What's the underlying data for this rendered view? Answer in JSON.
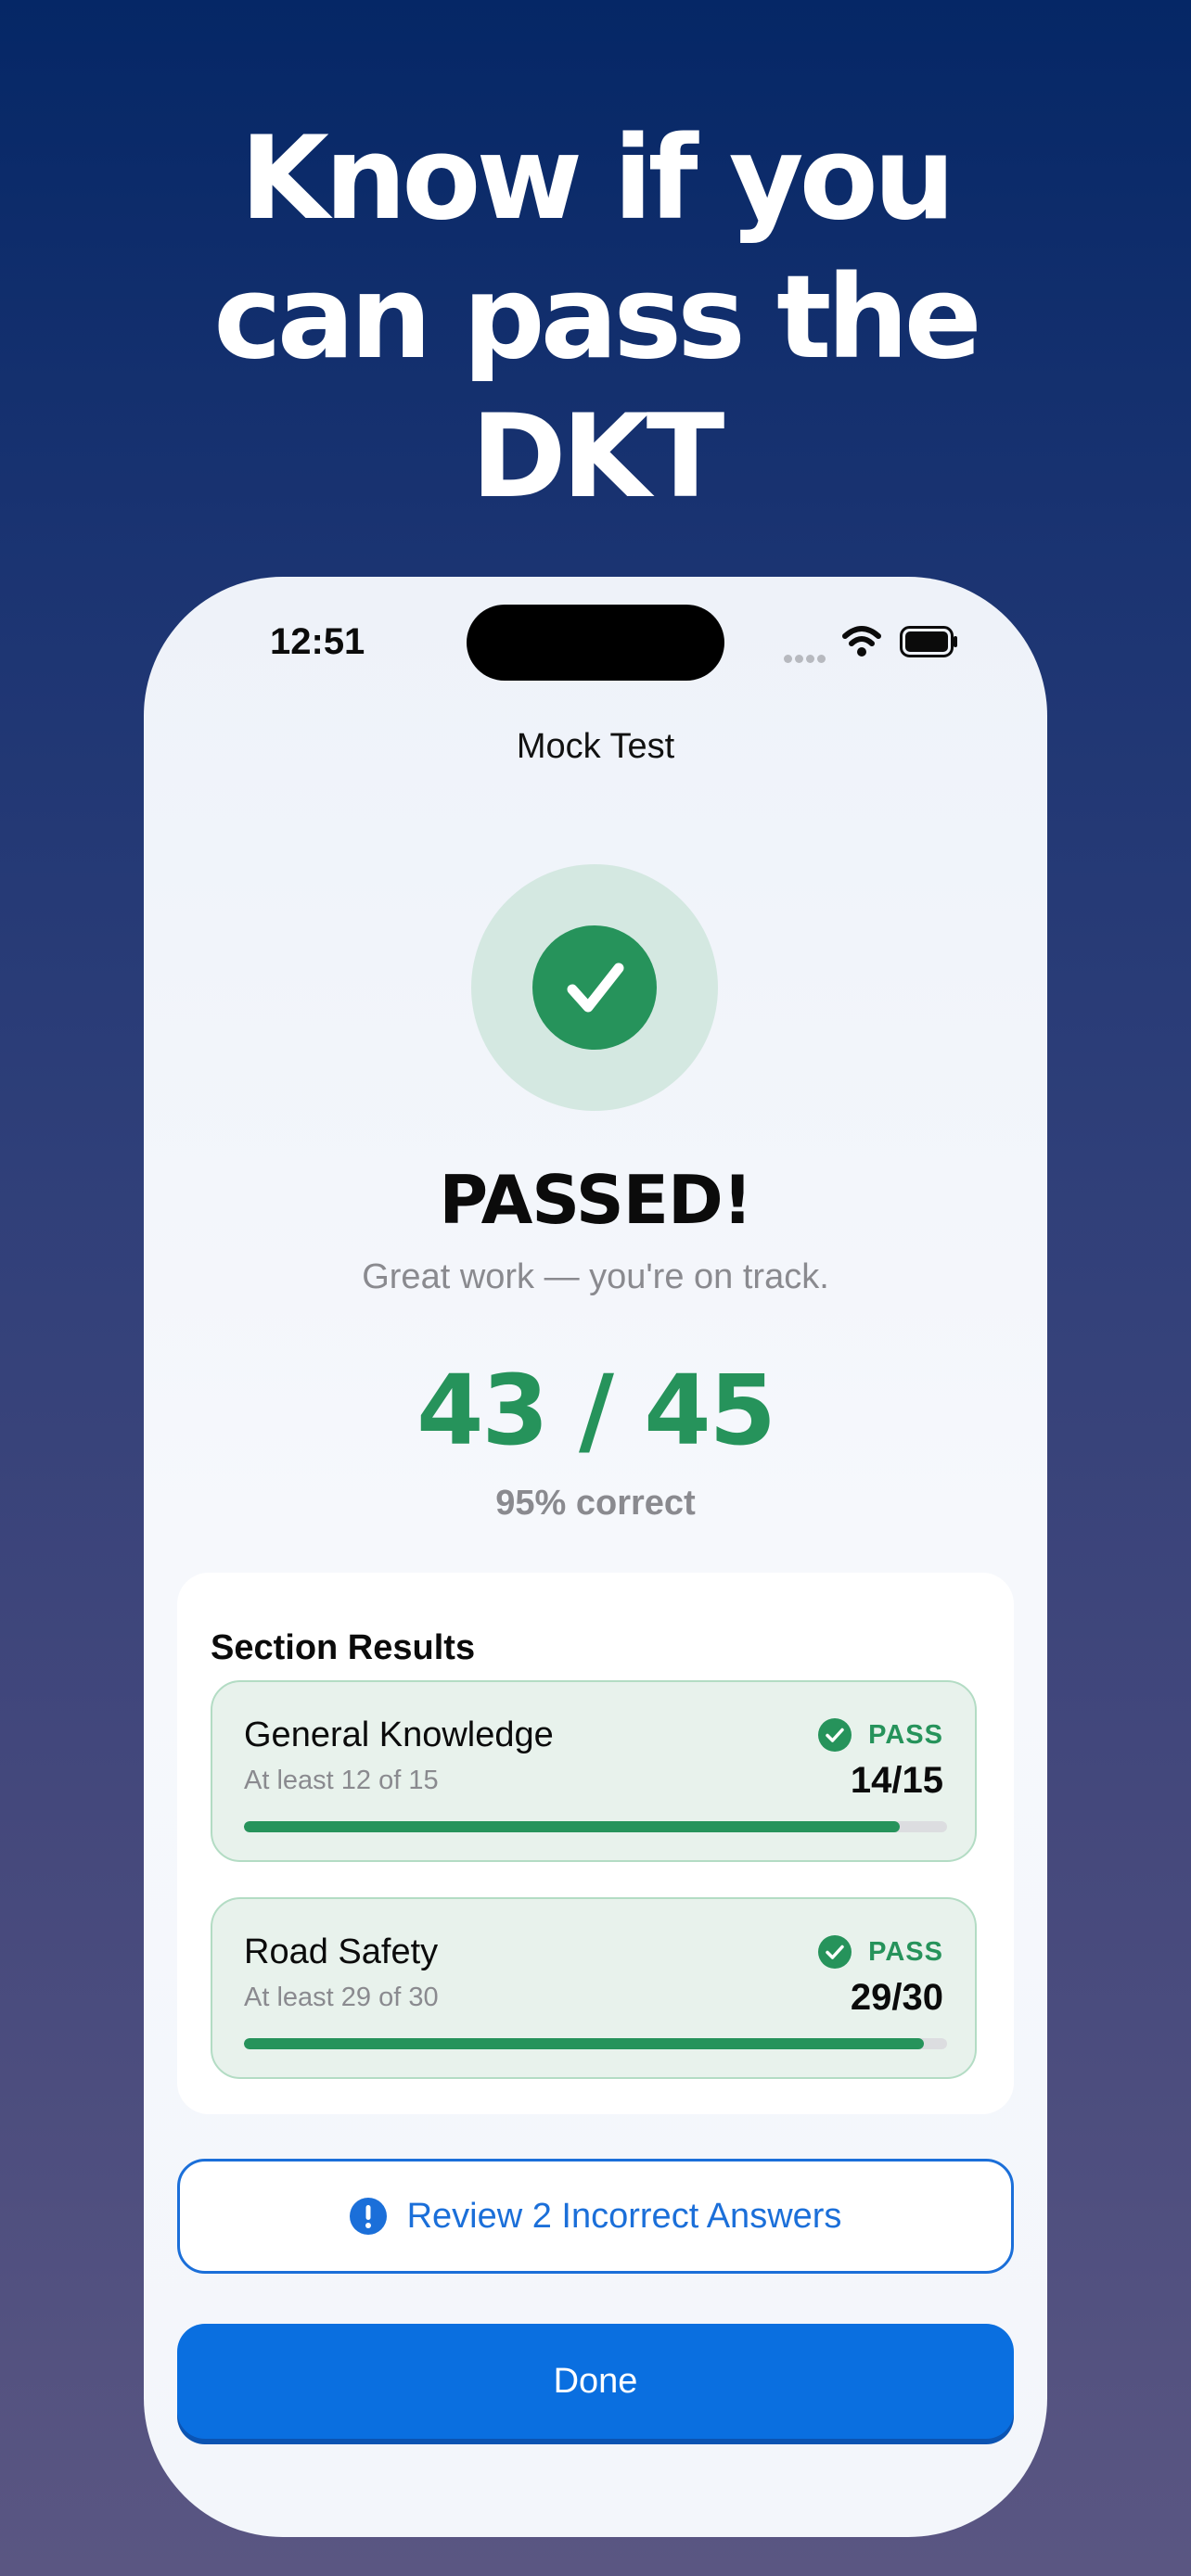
{
  "headline": {
    "line1": "Know if you",
    "line2": "can pass the",
    "line3": "DKT"
  },
  "status_bar": {
    "time": "12:51",
    "icons": [
      "cellular-signal-icon",
      "wifi-icon",
      "battery-icon"
    ]
  },
  "nav": {
    "title": "Mock Test"
  },
  "result": {
    "icon": "checkmark-circle-icon",
    "title": "PASSED!",
    "subtitle": "Great work — you're on track.",
    "score": "43 / 45",
    "percent": "95% correct"
  },
  "sections": {
    "heading": "Section Results",
    "items": [
      {
        "title": "General Knowledge",
        "requirement": "At least 12 of 15",
        "status": "PASS",
        "score": "14/15",
        "progress": 0.9333
      },
      {
        "title": "Road Safety",
        "requirement": "At least 29 of 30",
        "status": "PASS",
        "score": "29/30",
        "progress": 0.9667
      }
    ]
  },
  "actions": {
    "review_label": "Review 2 Incorrect Answers",
    "review_icon": "exclamation-circle-icon",
    "done_label": "Done"
  },
  "colors": {
    "success": "#26935b",
    "accent": "#0a6fe0",
    "background_top": "#052766",
    "background_bottom": "#5a5682"
  }
}
